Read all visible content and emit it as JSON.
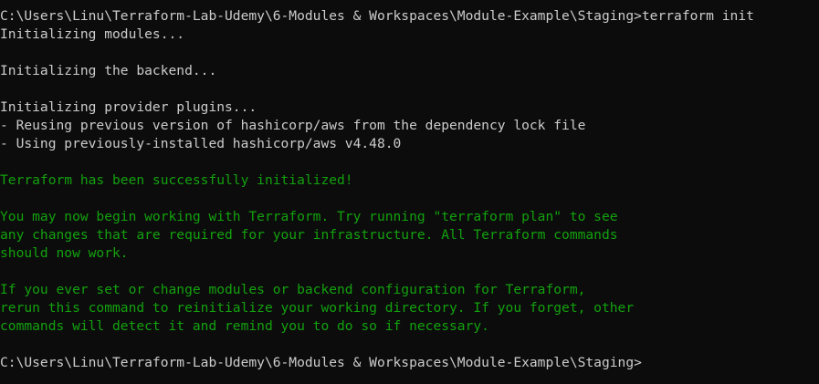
{
  "window": {
    "type": "console"
  },
  "colors": {
    "background": "#0c0c0c",
    "text": "#cccccc",
    "success": "#13a10e"
  },
  "terminal": {
    "command_line": "C:\\Users\\Linu\\Terraform-Lab-Udemy\\6-Modules & Workspaces\\Module-Example\\Staging>terraform init",
    "init_modules": "Initializing modules...",
    "init_backend": "Initializing the backend...",
    "init_plugins": "Initializing provider plugins...",
    "plugin_reuse": "- Reusing previous version of hashicorp/aws from the dependency lock file",
    "plugin_using": "- Using previously-installed hashicorp/aws v4.48.0",
    "success_message": "Terraform has been successfully initialized!",
    "info_para1_line1": "You may now begin working with Terraform. Try running \"terraform plan\" to see",
    "info_para1_line2": "any changes that are required for your infrastructure. All Terraform commands",
    "info_para1_line3": "should now work.",
    "info_para2_line1": "If you ever set or change modules or backend configuration for Terraform,",
    "info_para2_line2": "rerun this command to reinitialize your working directory. If you forget, other",
    "info_para2_line3": "commands will detect it and remind you to do so if necessary.",
    "prompt": "C:\\Users\\Linu\\Terraform-Lab-Udemy\\6-Modules & Workspaces\\Module-Example\\Staging>"
  }
}
